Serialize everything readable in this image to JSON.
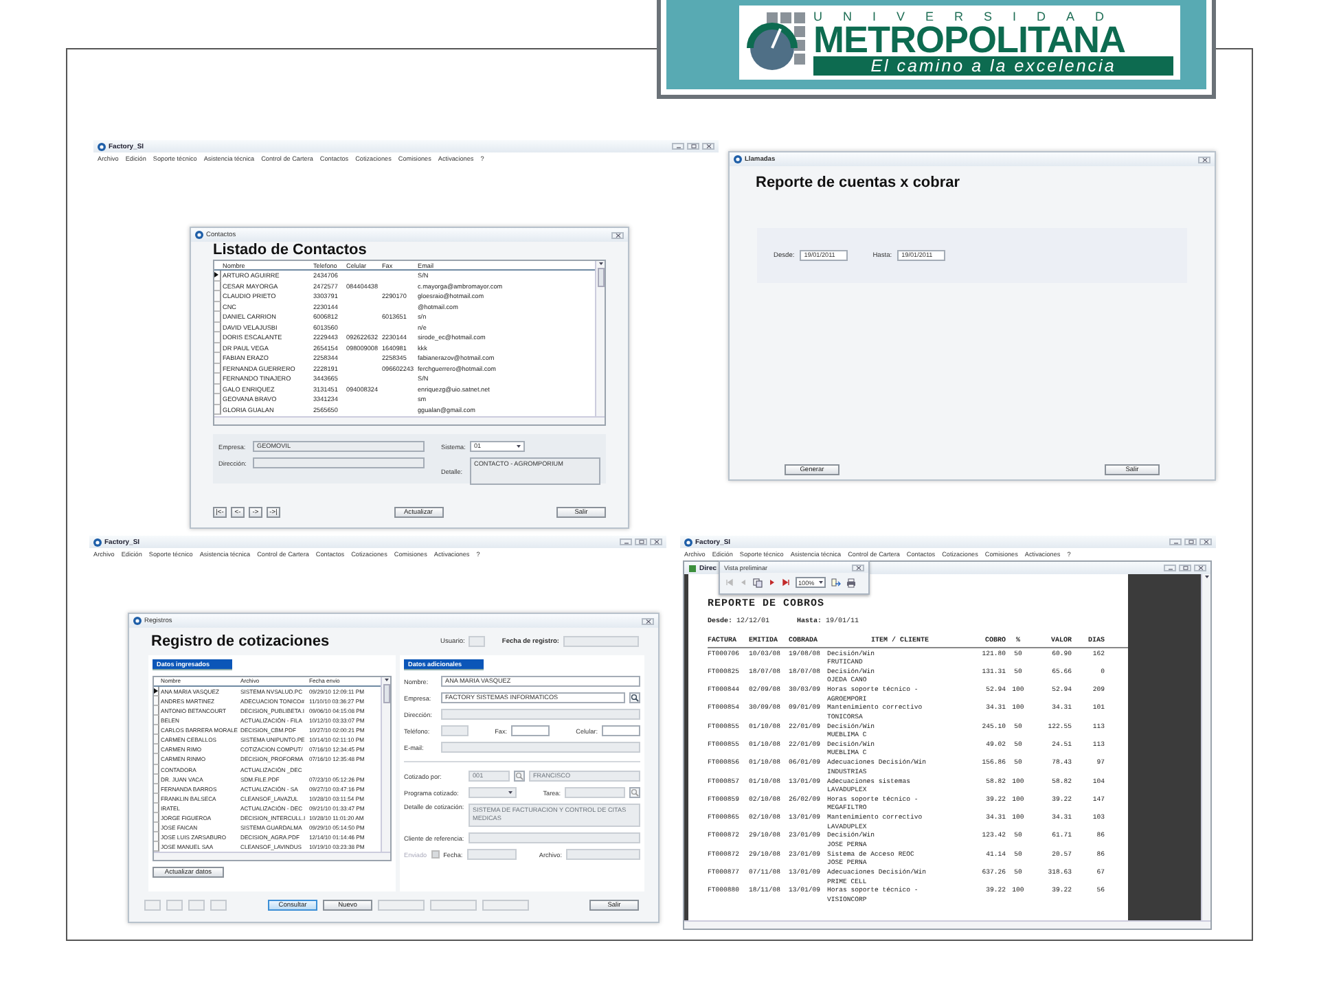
{
  "logo": {
    "overline": "UNIVERSIDAD",
    "name": "METROPOLITANA",
    "tagline": "El camino a la excelencia"
  },
  "contacts_screen": {
    "app_title": "Factory_SI",
    "menu": [
      "Archivo",
      "Edición",
      "Soporte técnico",
      "Asistencia técnica",
      "Control de Cartera",
      "Contactos",
      "Cotizaciones",
      "Comisiones",
      "Activaciones",
      "?"
    ],
    "dialog_title": "Contactos",
    "heading": "Listado de Contactos",
    "columns": [
      "Nombre",
      "Telefono",
      "Celular",
      "Fax",
      "Email"
    ],
    "rows": [
      {
        "cells": [
          "ARTURO AGUIRRE",
          "2434706",
          "",
          "",
          "S/N"
        ],
        "selected": true
      },
      {
        "cells": [
          "CESAR MAYORGA",
          "2472577",
          "084404438",
          "",
          "c.mayorga@ambromayor.com"
        ],
        "selected": false
      },
      {
        "cells": [
          "CLAUDIO PRIETO",
          "3303791",
          "",
          "2290170",
          "gloesraio@hotmail.com"
        ],
        "selected": false
      },
      {
        "cells": [
          "CNC",
          "2230144",
          "",
          "",
          "@hotmail.com"
        ],
        "selected": false
      },
      {
        "cells": [
          "DANIEL CARRION",
          "6006812",
          "",
          "6013651",
          "s/n"
        ],
        "selected": false
      },
      {
        "cells": [
          "DAVID VELAJUSBI",
          "6013560",
          "",
          "",
          "n/e"
        ],
        "selected": false
      },
      {
        "cells": [
          "DORIS ESCALANTE",
          "2229443",
          "092622632",
          "2230144",
          "sirode_ec@hotmail.com"
        ],
        "selected": false
      },
      {
        "cells": [
          "DR PAUL VEGA",
          "2654154",
          "098009008",
          "1640981",
          "kkk"
        ],
        "selected": false
      },
      {
        "cells": [
          "FABIAN ERAZO",
          "2258344",
          "",
          "2258345",
          "fabianerazov@hotmail.com"
        ],
        "selected": false
      },
      {
        "cells": [
          "FERNANDA GUERRERO",
          "2228191",
          "",
          "096602243",
          "ferchguerrero@hotmail.com"
        ],
        "selected": false
      },
      {
        "cells": [
          "FERNANDO TINAJERO",
          "3443665",
          "",
          "",
          "S/N"
        ],
        "selected": false
      },
      {
        "cells": [
          "GALO ENRIQUEZ",
          "3131451",
          "094008324",
          "",
          "enriquezg@uio.satnet.net"
        ],
        "selected": false
      },
      {
        "cells": [
          "GEOVANA BRAVO",
          "3341234",
          "",
          "",
          "sm"
        ],
        "selected": false
      },
      {
        "cells": [
          "GLORIA GUALAN",
          "2565650",
          "",
          "",
          "ggualan@gmail.com"
        ],
        "selected": false
      }
    ],
    "empresa_label": "Empresa:",
    "empresa_value": "GEOMOVIL",
    "direccion_label": "Dirección:",
    "sistema_label": "Sistema:",
    "sistema_value": "01",
    "detalle_label": "Detalle:",
    "detalle_value": "CONTACTO - AGROMPORIUM",
    "nav_buttons": [
      "|<-",
      "<-",
      "->",
      "->|"
    ],
    "update_button": "Actualizar",
    "exit_button": "Salir"
  },
  "calls_screen": {
    "dialog_title": "Llamadas",
    "heading": "Reporte de cuentas x cobrar",
    "from_label": "Desde:",
    "from_value": "19/01/2011",
    "to_label": "Hasta:",
    "to_value": "19/01/2011",
    "generate_button": "Generar",
    "exit_button": "Salir"
  },
  "quotes_screen": {
    "app_title": "Factory_SI",
    "menu": [
      "Archivo",
      "Edición",
      "Soporte técnico",
      "Asistencia técnica",
      "Control de Cartera",
      "Contactos",
      "Cotizaciones",
      "Comisiones",
      "Activaciones",
      "?"
    ],
    "dialog_title": "Registros",
    "heading": "Registro de cotizaciones",
    "user_label": "Usuario:",
    "user_disabled": true,
    "date_label": "Fecha de registro:",
    "date_disabled": true,
    "left_section": "Datos ingresados",
    "right_section": "Datos adicionales",
    "columns": [
      "Nombre",
      "Archivo",
      "Fecha envio"
    ],
    "rows": [
      {
        "cells": [
          "ANA MARIA VASQUEZ",
          "SISTEMA NVSALUD.PC",
          "09/29/10 12:09:11 PM"
        ],
        "selected": true
      },
      {
        "cells": [
          "ANDRES MARTINEZ",
          "ADECUACION TONICO#",
          "11/10/10 03:36:27 PM"
        ],
        "selected": false
      },
      {
        "cells": [
          "ANTONIO BETANCOURT",
          "DECISION_PUBLIBETA.I",
          "09/06/10 04:15:08 PM"
        ],
        "selected": false
      },
      {
        "cells": [
          "BELEN",
          "ACTUALIZACIÓN - FILA",
          "10/12/10 03:33:07 PM"
        ],
        "selected": false
      },
      {
        "cells": [
          "CARLOS BARRERA MORALE",
          "DECISION_CBM.PDF",
          "10/27/10 02:00:21 PM"
        ],
        "selected": false
      },
      {
        "cells": [
          "CARMEN CEBALLOS",
          "SISTEMA UNIPUNTO.PE",
          "10/14/10 02:11:10 PM"
        ],
        "selected": false
      },
      {
        "cells": [
          "CARMEN RIMO",
          "COTIZACION COMPUT/",
          "07/16/10 12:34:45 PM"
        ],
        "selected": false
      },
      {
        "cells": [
          "CARMEN RINMO",
          "DECISION_PROFORMA",
          "07/16/10 12:35:48 PM"
        ],
        "selected": false
      },
      {
        "cells": [
          "CONTADORA",
          "ACTUALIZACIÓN _DEC",
          ""
        ],
        "selected": false
      },
      {
        "cells": [
          "DR. JUAN VACA",
          "SDM.FILE.PDF",
          "07/23/10 05:12:26 PM"
        ],
        "selected": false
      },
      {
        "cells": [
          "FERNANDA BARROS",
          "ACTUALIZACIÓN - SA",
          "09/27/10 03:47:16 PM"
        ],
        "selected": false
      },
      {
        "cells": [
          "FRANKLIN BALSECA",
          "CLEANSOF_LAVAZUL",
          "10/28/10 03:11:54 PM"
        ],
        "selected": false
      },
      {
        "cells": [
          "IRATEL",
          "ACTUALIZACIÓN - DEC",
          "09/21/10 01:33:47 PM"
        ],
        "selected": false
      },
      {
        "cells": [
          "JORGE FIGUEROA",
          "DECISION_INTERCULL.I",
          "10/28/10 11:01:20 AM"
        ],
        "selected": false
      },
      {
        "cells": [
          "JOSE FAICAN",
          "SISTEMA GUARDALMA",
          "09/29/10 05:14:50 PM"
        ],
        "selected": false
      },
      {
        "cells": [
          "JOSE LUIS ZARSABURO",
          "DECISION_AGRA.PDF",
          "12/14/10 01:14:46 PM"
        ],
        "selected": false
      },
      {
        "cells": [
          "JOSE MANUEL SAA",
          "CLEANSOF_LAVINDUS",
          "10/19/10 03:23:38 PM"
        ],
        "selected": false
      }
    ],
    "refresh_button": "Actualizar datos",
    "form": {
      "name": {
        "label": "Nombre:",
        "value": "ANA MARIA VASQUEZ"
      },
      "company": {
        "label": "Empresa:",
        "value": "FACTORY SISTEMAS INFORMATICOS"
      },
      "address": {
        "label": "Dirección:",
        "disabled": true
      },
      "phone": {
        "label": "Teléfono:",
        "disabled": true
      },
      "fax": {
        "label": "Fax:"
      },
      "mobile": {
        "label": "Celular:"
      },
      "email": {
        "label": "E-mail:",
        "disabled": true
      },
      "quoted_by": {
        "label": "Cotizado por:",
        "code": "001",
        "name": "FRANCISCO",
        "disabled": true
      },
      "program": {
        "label": "Programa cotizado:",
        "disabled": true
      },
      "task": {
        "label": "Tarea:",
        "disabled": true
      },
      "detail": {
        "label": "Detalle de cotización:",
        "value": "SISTEMA DE FACTURACION Y CONTROL DE CITAS MEDICAS",
        "disabled": true
      },
      "reference": {
        "label": "Cliente de referencia:",
        "disabled": true
      },
      "sent": {
        "label": "Enviado",
        "checked": false,
        "disabled": true
      },
      "date": {
        "label": "Fecha:",
        "disabled": true
      },
      "file": {
        "label": "Archivo:",
        "disabled": true
      }
    },
    "bottom_buttons": [
      {
        "disabled": true,
        "focused": false
      },
      {
        "disabled": true,
        "focused": false
      },
      {
        "disabled": true,
        "focused": false
      },
      {
        "disabled": true,
        "focused": false
      },
      {
        "label": "Consultar",
        "disabled": false,
        "focused": true
      },
      {
        "label": "Nuevo",
        "disabled": false,
        "focused": false
      },
      {
        "disabled": true,
        "focused": false
      },
      {
        "disabled": true,
        "focused": false
      },
      {
        "disabled": true,
        "focused": false
      },
      {
        "label": "Salir",
        "disabled": false,
        "focused": false
      }
    ]
  },
  "report_screen": {
    "app_title": "Factory_SI",
    "menu": [
      "Archivo",
      "Edición",
      "Soporte técnico",
      "Asistencia técnica",
      "Control de Cartera",
      "Contactos",
      "Cotizaciones",
      "Comisiones",
      "Activaciones",
      "?"
    ],
    "inner_title": "Direc",
    "preview": {
      "title": "Vista preliminar",
      "tools": [
        {
          "kind": "first",
          "disabled": true
        },
        {
          "kind": "prev",
          "disabled": true
        },
        {
          "kind": "copy",
          "disabled": false
        },
        {
          "kind": "next",
          "disabled": false
        },
        {
          "kind": "last",
          "disabled": false
        },
        {
          "kind": "zoom",
          "value": "100%"
        },
        {
          "kind": "export",
          "disabled": false
        },
        {
          "kind": "print",
          "disabled": false
        }
      ]
    },
    "report": {
      "title": "REPORTE DE COBROS",
      "from_label": "Desde:",
      "from_value": "12/12/01",
      "to_label": "Hasta:",
      "to_value": "19/01/11",
      "columns": [
        "FACTURA",
        "EMITIDA",
        "COBRADA",
        "ITEM / CLIENTE",
        "COBRO",
        "%",
        "VALOR",
        "DIAS"
      ],
      "rows": [
        {
          "invoice": "FT000706",
          "issued": "10/03/08",
          "collected": "19/08/08",
          "item": "Decisión/Win",
          "client": "FRUTICAND",
          "amount": "121.80",
          "percent": "50",
          "value": "60.90",
          "days": "162"
        },
        {
          "invoice": "FT000825",
          "issued": "18/07/08",
          "collected": "18/07/08",
          "item": "Decisión/Win",
          "client": "OJEDA CANO",
          "amount": "131.31",
          "percent": "50",
          "value": "65.66",
          "days": "0"
        },
        {
          "invoice": "FT000844",
          "issued": "02/09/08",
          "collected": "30/03/09",
          "item": "Horas soporte técnico -",
          "client": "AGROEMPORI",
          "amount": "52.94",
          "percent": "100",
          "value": "52.94",
          "days": "209"
        },
        {
          "invoice": "FT000854",
          "issued": "30/09/08",
          "collected": "09/01/09",
          "item": "Mantenimiento correctivo",
          "client": "TONICORSA",
          "amount": "34.31",
          "percent": "100",
          "value": "34.31",
          "days": "101"
        },
        {
          "invoice": "FT000855",
          "issued": "01/10/08",
          "collected": "22/01/09",
          "item": "Decisión/Win",
          "client": "MUEBLIMA C",
          "amount": "245.10",
          "percent": "50",
          "value": "122.55",
          "days": "113"
        },
        {
          "invoice": "FT000855",
          "issued": "01/10/08",
          "collected": "22/01/09",
          "item": "Decisión/Win",
          "client": "MUEBLIMA C",
          "amount": "49.02",
          "percent": "50",
          "value": "24.51",
          "days": "113"
        },
        {
          "invoice": "FT000856",
          "issued": "01/10/08",
          "collected": "06/01/09",
          "item": "Adecuaciones Decisión/Win",
          "client": "INDUSTRIAS",
          "amount": "156.86",
          "percent": "50",
          "value": "78.43",
          "days": "97"
        },
        {
          "invoice": "FT000857",
          "issued": "01/10/08",
          "collected": "13/01/09",
          "item": "Adecuaciones sistemas",
          "client": "LAVADUPLEX",
          "amount": "58.82",
          "percent": "100",
          "value": "58.82",
          "days": "104"
        },
        {
          "invoice": "FT000859",
          "issued": "02/10/08",
          "collected": "26/02/09",
          "item": "Horas soporte técnico -",
          "client": "MEGAFILTRO",
          "amount": "39.22",
          "percent": "100",
          "value": "39.22",
          "days": "147"
        },
        {
          "invoice": "FT000865",
          "issued": "02/10/08",
          "collected": "13/01/09",
          "item": "Mantenimiento correctivo",
          "client": "LAVADUPLEX",
          "amount": "34.31",
          "percent": "100",
          "value": "34.31",
          "days": "103"
        },
        {
          "invoice": "FT000872",
          "issued": "29/10/08",
          "collected": "23/01/09",
          "item": "Decisión/Win",
          "client": "JOSE PERNA",
          "amount": "123.42",
          "percent": "50",
          "value": "61.71",
          "days": "86"
        },
        {
          "invoice": "FT000872",
          "issued": "29/10/08",
          "collected": "23/01/09",
          "item": "Sistema de Acceso REOC",
          "client": "JOSE PERNA",
          "amount": "41.14",
          "percent": "50",
          "value": "20.57",
          "days": "86"
        },
        {
          "invoice": "FT000877",
          "issued": "07/11/08",
          "collected": "13/01/09",
          "item": "Adecuaciones Decisión/Win",
          "client": "PRIME CELL",
          "amount": "637.26",
          "percent": "50",
          "value": "318.63",
          "days": "67"
        },
        {
          "invoice": "FT000880",
          "issued": "18/11/08",
          "collected": "13/01/09",
          "item": "Horas soporte técnico -",
          "client": "VISIONCORP",
          "amount": "39.22",
          "percent": "100",
          "value": "39.22",
          "days": "56"
        }
      ]
    }
  }
}
